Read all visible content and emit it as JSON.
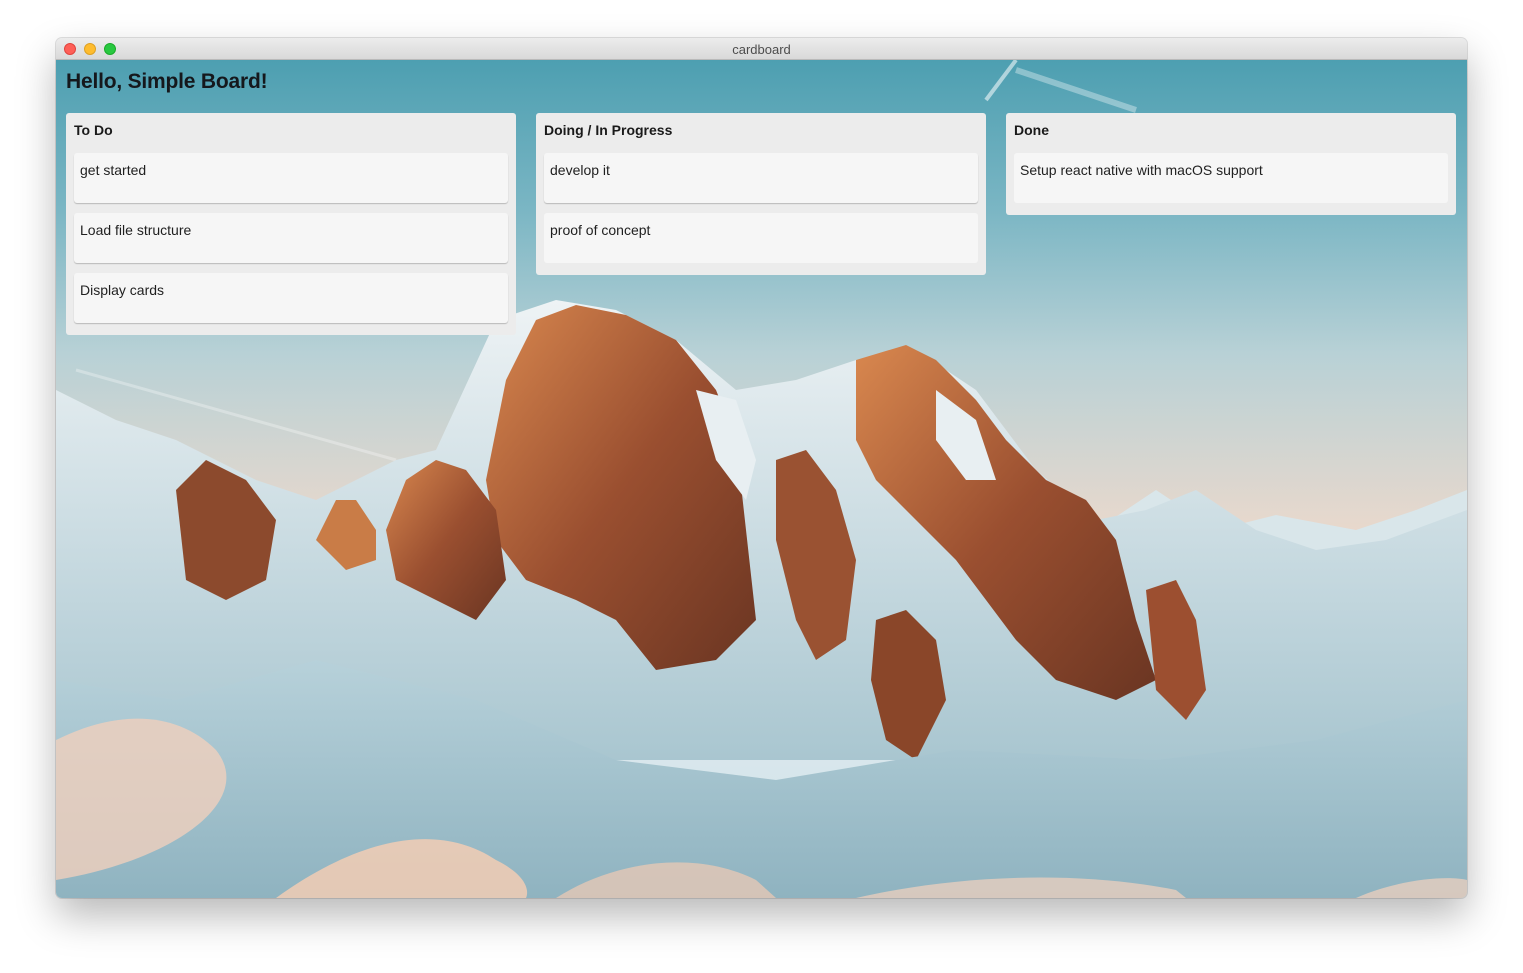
{
  "window": {
    "title": "cardboard"
  },
  "board": {
    "title": "Hello, Simple Board!"
  },
  "columns": [
    {
      "title": "To Do",
      "cards": [
        "get started",
        "Load file structure",
        "Display cards"
      ]
    },
    {
      "title": "Doing / In Progress",
      "cards": [
        "develop it",
        "proof of concept"
      ]
    },
    {
      "title": "Done",
      "cards": [
        "Setup react native with macOS support"
      ]
    }
  ],
  "colors": {
    "column_bg": "#ececec",
    "card_bg": "#f6f6f6",
    "sky": "#4d9fb1",
    "snow": "#dfeaef",
    "rock": "#a0502e"
  }
}
